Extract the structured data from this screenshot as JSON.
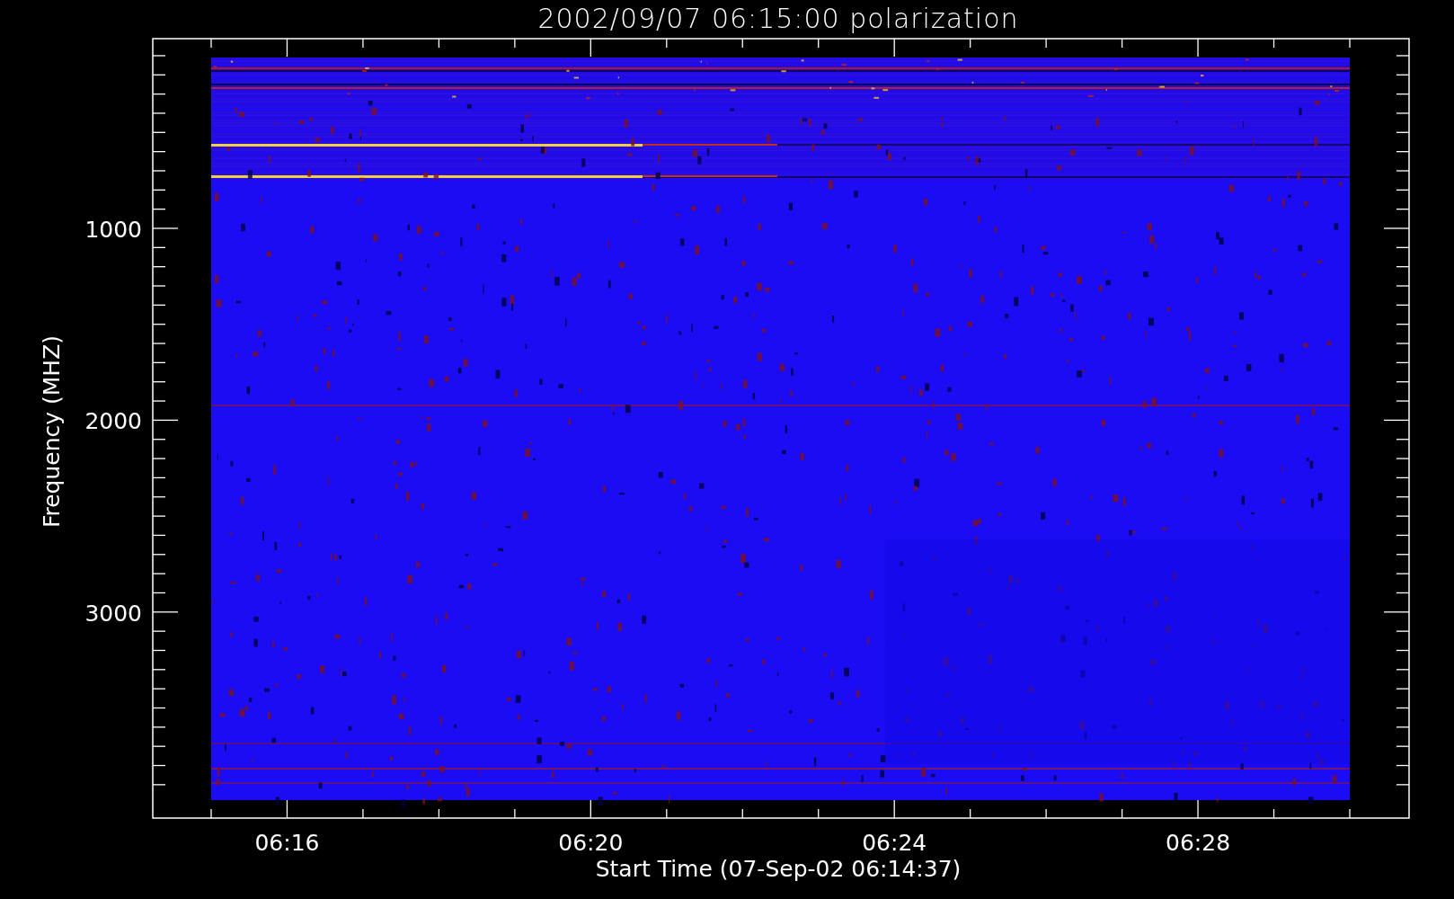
{
  "title": "2002/09/07 06:15:00 polarization",
  "plot": {
    "ylabel": "Frequency (MHZ)",
    "xlabel": "Start Time (07-Sep-02 06:14:37)",
    "yticks": [
      "1000",
      "2000",
      "3000"
    ],
    "xticks": [
      "06:16",
      "06:20",
      "06:24",
      "06:28"
    ]
  }
}
